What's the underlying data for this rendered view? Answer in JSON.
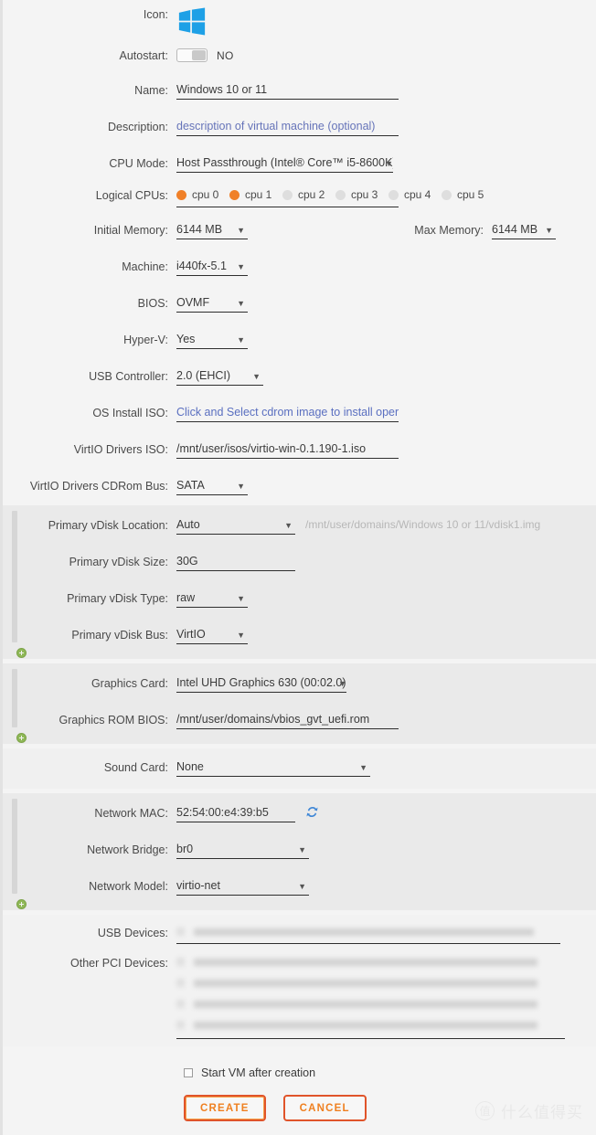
{
  "form": {
    "icon": {
      "label": "Icon:",
      "icon_name": "windows-logo-icon",
      "color": "#1ea0e6"
    },
    "autostart": {
      "label": "Autostart:",
      "value": "NO",
      "state": "off"
    },
    "name": {
      "label": "Name:",
      "value": "Windows 10 or 11"
    },
    "description": {
      "label": "Description:",
      "placeholder": "description of virtual machine (optional)"
    },
    "cpu_mode": {
      "label": "CPU Mode:",
      "value": "Host Passthrough (Intel® Core™ i5-8600K)"
    },
    "logical_cpus": {
      "label": "Logical CPUs:",
      "items": [
        {
          "label": "cpu 0",
          "checked": true
        },
        {
          "label": "cpu 1",
          "checked": true
        },
        {
          "label": "cpu 2",
          "checked": false
        },
        {
          "label": "cpu 3",
          "checked": false
        },
        {
          "label": "cpu 4",
          "checked": false
        },
        {
          "label": "cpu 5",
          "checked": false
        }
      ]
    },
    "initial_memory": {
      "label": "Initial Memory:",
      "value": "6144 MB"
    },
    "max_memory": {
      "label": "Max Memory:",
      "value": "6144 MB"
    },
    "machine": {
      "label": "Machine:",
      "value": "i440fx-5.1"
    },
    "bios": {
      "label": "BIOS:",
      "value": "OVMF"
    },
    "hyperv": {
      "label": "Hyper-V:",
      "value": "Yes"
    },
    "usb_controller": {
      "label": "USB Controller:",
      "value": "2.0 (EHCI)"
    },
    "os_install_iso": {
      "label": "OS Install ISO:",
      "value": "Click and Select cdrom image to install operati"
    },
    "virtio_drivers_iso": {
      "label": "VirtIO Drivers ISO:",
      "value": "/mnt/user/isos/virtio-win-0.1.190-1.iso"
    },
    "virtio_cdrom_bus": {
      "label": "VirtIO Drivers CDRom Bus:",
      "value": "SATA"
    },
    "vdisk_location": {
      "label": "Primary vDisk Location:",
      "value": "Auto",
      "hint": "/mnt/user/domains/Windows 10 or 11/vdisk1.img"
    },
    "vdisk_size": {
      "label": "Primary vDisk Size:",
      "value": "30G"
    },
    "vdisk_type": {
      "label": "Primary vDisk Type:",
      "value": "raw"
    },
    "vdisk_bus": {
      "label": "Primary vDisk Bus:",
      "value": "VirtIO"
    },
    "graphics_card": {
      "label": "Graphics Card:",
      "value": "Intel UHD Graphics 630 (00:02.0)"
    },
    "graphics_rom_bios": {
      "label": "Graphics ROM BIOS:",
      "value": "/mnt/user/domains/vbios_gvt_uefi.rom"
    },
    "sound_card": {
      "label": "Sound Card:",
      "value": "None"
    },
    "network_mac": {
      "label": "Network MAC:",
      "value": "52:54:00:e4:39:b5",
      "refresh_icon": "refresh-icon"
    },
    "network_bridge": {
      "label": "Network Bridge:",
      "value": "br0"
    },
    "network_model": {
      "label": "Network Model:",
      "value": "virtio-net"
    },
    "usb_devices": {
      "label": "USB Devices:",
      "rows": 1,
      "redacted": true
    },
    "other_pci_devices": {
      "label": "Other PCI Devices:",
      "rows": 4,
      "redacted": true
    },
    "start_after_creation": {
      "label": "Start VM after creation",
      "checked": false
    },
    "create_button": "CREATE",
    "cancel_button": "CANCEL"
  },
  "watermark": {
    "mark": "值",
    "text": "什么值得买"
  }
}
